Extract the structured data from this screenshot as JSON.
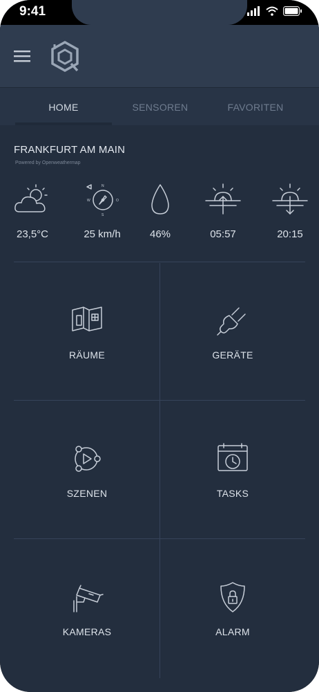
{
  "status_bar": {
    "time": "9:41"
  },
  "tabs": [
    {
      "label": "HOME",
      "active": true
    },
    {
      "label": "SENSOREN",
      "active": false
    },
    {
      "label": "FAVORITEN",
      "active": false
    }
  ],
  "weather": {
    "city": "FRANKFURT AM MAIN",
    "powered_by": "Powered by Openweathermap",
    "items": [
      {
        "icon": "cloud-sun-icon",
        "value": "23,5°C"
      },
      {
        "icon": "wind-compass-icon",
        "value": "25 km/h"
      },
      {
        "icon": "humidity-drop-icon",
        "value": "46%"
      },
      {
        "icon": "sunrise-icon",
        "value": "05:57"
      },
      {
        "icon": "sunset-icon",
        "value": "20:15"
      }
    ]
  },
  "tiles": [
    {
      "icon": "room-icon",
      "label": "RÄUME"
    },
    {
      "icon": "plug-icon",
      "label": "GERÄTE"
    },
    {
      "icon": "scenes-icon",
      "label": "SZENEN"
    },
    {
      "icon": "calendar-clock-icon",
      "label": "TASKS"
    },
    {
      "icon": "camera-icon",
      "label": "KAMERAS"
    },
    {
      "icon": "shield-lock-icon",
      "label": "ALARM"
    }
  ],
  "colors": {
    "background": "#232e3e",
    "header": "#2f3c4f",
    "tabs": "#283446",
    "text": "#dde3ea",
    "muted": "#6f7c8f"
  }
}
